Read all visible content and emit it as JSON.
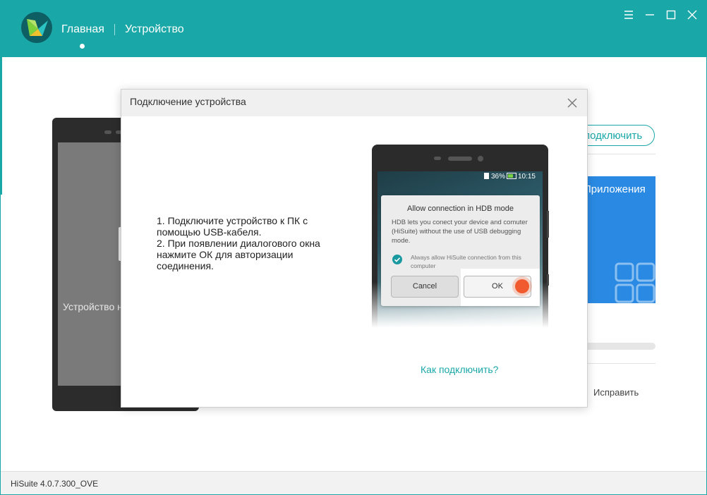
{
  "app": {
    "nav": {
      "home": "Главная",
      "device": "Устройство"
    },
    "version": "HiSuite 4.0.7.300_OVE"
  },
  "window_controls": [
    "menu-icon",
    "minimize-icon",
    "maximize-icon",
    "close-icon"
  ],
  "background": {
    "phone_status_text": "Устройство н",
    "connect_button": "подключить",
    "apps_card_label": "Приложения",
    "fix_link": "Исправить"
  },
  "dialog": {
    "title": "Подключение устройства",
    "instructions": [
      "1. Подключите устройство к ПК с помощью USB-кабеля.",
      "2. При появлении диалогового окна нажмите ОК для авторизации соединения."
    ],
    "how_to_connect": "Как подключить?",
    "phone": {
      "battery": "36%",
      "time": "10:15",
      "prompt_title": "Allow connection in HDB mode",
      "prompt_body": "HDB lets you conect your device and comuter (HiSuite) without the use of USB debugging mode.",
      "checkbox_label": "Always allow HiSuite connection from this computer",
      "checkbox_checked": true,
      "cancel": "Cancel",
      "ok": "OK"
    }
  },
  "colors": {
    "accent": "#1aa7a8",
    "apps_card": "#2a8ae3",
    "tap_indicator": "#f05a2e"
  }
}
